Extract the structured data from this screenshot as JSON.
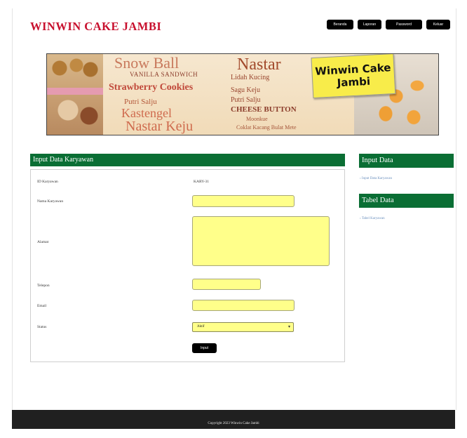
{
  "header": {
    "brand": "WINWIN CAKE JAMBI",
    "nav": [
      "Beranda",
      "Laporan",
      "Password",
      "Keluar"
    ]
  },
  "banner": {
    "texts": [
      "Snow Ball",
      "VANILLA SANDWICH",
      "Strawberry Cookies",
      "Putri Salju",
      "Kastengel",
      "Nastar Keju",
      "Nastar",
      "Lidah Kucing",
      "Sagu Keju",
      "Putri Salju",
      "CHEESE BUTTON",
      "Moonkue",
      "Coklat Kacang Bulat Mete"
    ],
    "sticker": "Winwin Cake Jambi"
  },
  "form": {
    "title": "Input Data Karyawan",
    "fields": [
      {
        "label": "ID Karyawan",
        "value": "KARY-31"
      },
      {
        "label": "Nama Karyawan",
        "value": ""
      },
      {
        "label": "Alamat",
        "value": ""
      },
      {
        "label": "Telepon",
        "value": ""
      },
      {
        "label": "Email",
        "value": ""
      },
      {
        "label": "Status",
        "value": "Aktif"
      }
    ],
    "submit": "Input"
  },
  "sidebar": {
    "input_header": "Input Data",
    "input_link": "› Input Data Karyawan",
    "table_header": "Tabel Data",
    "table_link": "› Tabel Karyawan"
  },
  "footer": {
    "text": "Copyright 2023 Winwin Cake Jambi"
  }
}
